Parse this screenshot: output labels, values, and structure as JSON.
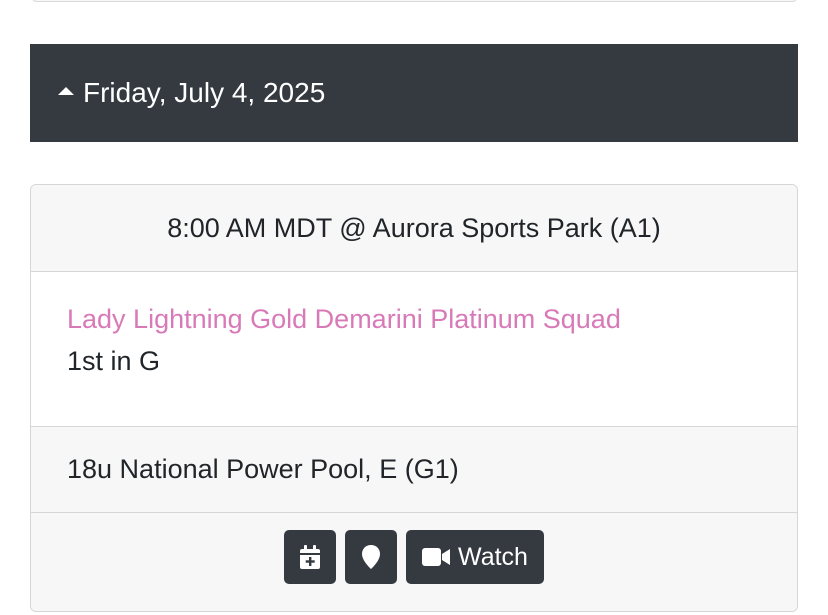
{
  "day_header": {
    "date": "Friday, July 4, 2025",
    "icon": "caret-up-icon"
  },
  "game": {
    "time_location": "8:00 AM MDT @ Aurora Sports Park (A1)",
    "team_name": "Lady Lightning Gold Demarini Platinum Squad",
    "seed": "1st in G",
    "pool": "18u National Power Pool, E (G1)",
    "actions": {
      "calendar_icon": "calendar-plus-icon",
      "map_icon": "map-marker-icon",
      "watch_icon": "video-camera-icon",
      "watch_label": "Watch"
    }
  },
  "colors": {
    "header_bg": "#343a40",
    "team_link": "#d87ab8",
    "card_bg": "#f7f7f7"
  }
}
